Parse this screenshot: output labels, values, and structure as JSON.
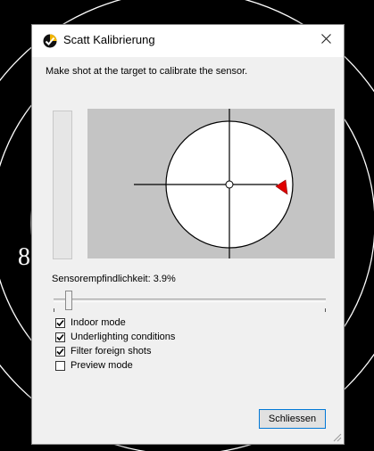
{
  "background": {
    "target_digit": "8"
  },
  "dialog": {
    "title": "Scatt Kalibrierung",
    "app_icon": "scatt-app-icon",
    "close_icon": "close-icon",
    "instruction": "Make shot at the target to calibrate the sensor.",
    "target_view": {
      "shot_marker_icon": "red-triangle-marker-icon",
      "shot_marker_color": "#e00000"
    },
    "sensitivity": {
      "label": "Sensorempfindlichkeit: 3.9%",
      "value_percent": 3.9
    },
    "options": [
      {
        "label": "Indoor mode",
        "checked": true
      },
      {
        "label": "Underlighting conditions",
        "checked": true
      },
      {
        "label": "Filter foreign shots",
        "checked": true
      },
      {
        "label": "Preview mode",
        "checked": false
      }
    ],
    "close_button_label": "Schliessen"
  }
}
